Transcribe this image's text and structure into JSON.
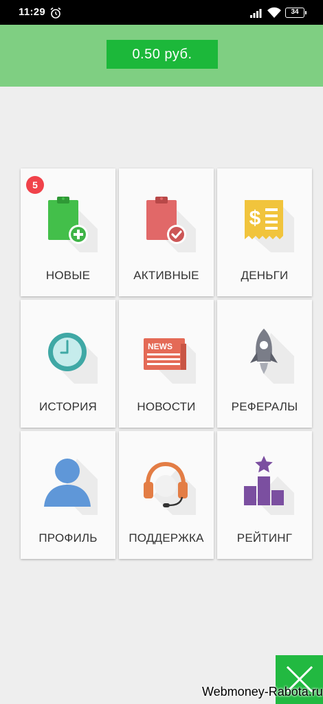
{
  "status_bar": {
    "time": "11:29",
    "battery": "34"
  },
  "header": {
    "balance": "0.50 руб."
  },
  "menu": [
    {
      "label": "НОВЫЕ",
      "icon": "new-tasks-icon",
      "badge": "5"
    },
    {
      "label": "АКТИВНЫЕ",
      "icon": "active-tasks-icon"
    },
    {
      "label": "ДЕНЬГИ",
      "icon": "money-icon"
    },
    {
      "label": "ИСТОРИЯ",
      "icon": "clock-icon"
    },
    {
      "label": "НОВОСТИ",
      "icon": "news-icon",
      "icon_text": "NEWS"
    },
    {
      "label": "РЕФЕРАЛЫ",
      "icon": "rocket-icon"
    },
    {
      "label": "ПРОФИЛЬ",
      "icon": "user-icon"
    },
    {
      "label": "ПОДДЕРЖКА",
      "icon": "headset-icon"
    },
    {
      "label": "РЕЙТИНГ",
      "icon": "podium-icon"
    }
  ],
  "watermark": "Webmoney-Rabota.ru",
  "colors": {
    "header": "#7fcf82",
    "balance": "#1cb83a",
    "badge": "#f0424a",
    "fab": "#22b941"
  }
}
